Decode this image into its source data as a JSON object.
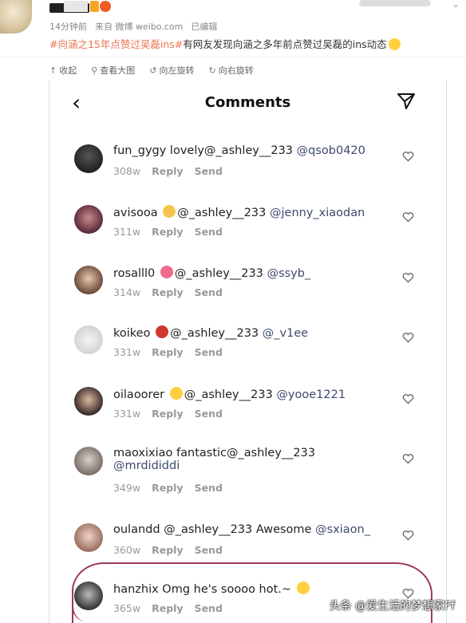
{
  "post": {
    "meta_time": "14分钟前",
    "meta_source": "来自 微博 weibo.com",
    "meta_edited": "已编辑",
    "hashtag": "#向涵之15年点赞过吴磊ins#",
    "text": "有网友发现向涵之多年前点赞过吴磊的ins动态"
  },
  "toolbar": {
    "collapse": "收起",
    "view_large": "查看大图",
    "rotate_left": "向左旋转",
    "rotate_right": "向右旋转"
  },
  "ig": {
    "back_icon": "chevron-left-icon",
    "title": "Comments",
    "send_icon": "paper-plane-icon"
  },
  "comments": [
    {
      "user": "fun_gygy",
      "text": "lovely@_ashley__233",
      "mention": "@qsob0420",
      "time": "308w",
      "reply": "Reply",
      "send": "Send",
      "emoji": ""
    },
    {
      "user": "avisooa",
      "text": "@_ashley__233",
      "mention": "@jenny_xiaodan",
      "time": "311w",
      "reply": "Reply",
      "send": "Send",
      "emoji": "victory-hand"
    },
    {
      "user": "rosalll0",
      "text": "@_ashley__233",
      "mention": "@ssyb_",
      "time": "314w",
      "reply": "Reply",
      "send": "Send",
      "emoji": "heart"
    },
    {
      "user": "koikeo",
      "text": "@_ashley__233",
      "mention": "@_v1ee",
      "time": "331w",
      "reply": "Reply",
      "send": "Send",
      "emoji": "dancer"
    },
    {
      "user": "oilaoorer",
      "text": "@_ashley__233",
      "mention": "@yooe1221",
      "time": "331w",
      "reply": "Reply",
      "send": "Send",
      "emoji": "sunglasses"
    },
    {
      "user": "maoxixiao",
      "text": "fantastic@_ashley__233",
      "mention": "@mrdididdi",
      "time": "349w",
      "reply": "Reply",
      "send": "Send",
      "emoji": ""
    },
    {
      "user": "oulandd",
      "text": "@_ashley__233 Awesome",
      "mention": "@sxiaon_",
      "time": "360w",
      "reply": "Reply",
      "send": "Send",
      "emoji": ""
    },
    {
      "user": "hanzhix",
      "text": "Omg he's soooo hot.~",
      "mention": "",
      "time": "365w",
      "reply": "Reply",
      "send": "Send",
      "emoji": "heart-eyes"
    }
  ],
  "watermark": "头条 @爱生活的梦想家Ff",
  "colors": {
    "hashtag": "#eb7350",
    "mention": "#3d4a6e",
    "circle": "#9c3a5a"
  }
}
